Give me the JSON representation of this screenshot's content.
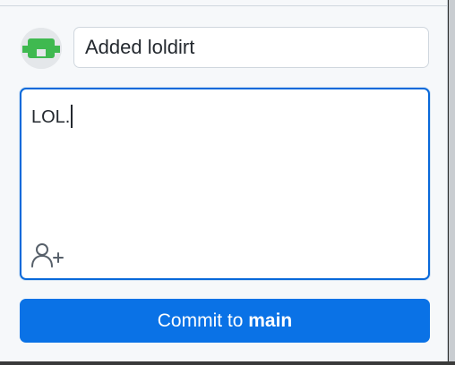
{
  "commit_panel": {
    "summary": {
      "value": "Added loldirt"
    },
    "description": {
      "value": "LOL."
    },
    "coauthor_icon": "add-person-icon",
    "avatar_icon": "identicon-avatar",
    "commit_button": {
      "prefix": "Commit to ",
      "branch": "main"
    }
  },
  "colors": {
    "accent": "#0969da",
    "button": "#0a72e6",
    "avatar_green": "#3fb950"
  }
}
